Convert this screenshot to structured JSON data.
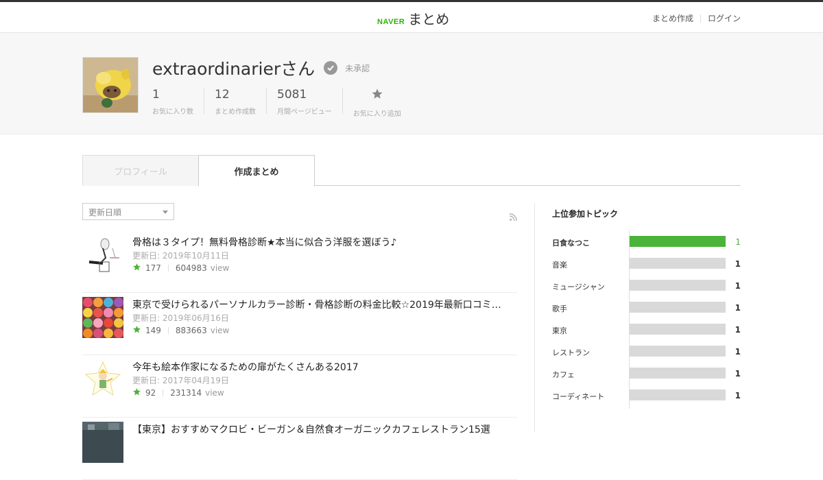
{
  "header": {
    "logo_naver": "NAVER",
    "logo_matome": "まとめ",
    "create_link": "まとめ作成",
    "login_link": "ログイン"
  },
  "profile": {
    "username": "extraordinarierさん",
    "status": "未承認",
    "stats": [
      {
        "num": "1",
        "label": "お気に入り数"
      },
      {
        "num": "12",
        "label": "まとめ作成数"
      },
      {
        "num": "5081",
        "label": "月間ページビュー"
      }
    ],
    "fav_add_label": "お気に入り追加"
  },
  "tabs": {
    "profile": "プロフィール",
    "created": "作成まとめ"
  },
  "sort_select": {
    "value": "更新日順"
  },
  "list": [
    {
      "title": "骨格は３タイプ！無料骨格診断★本当に似合う洋服を選ぼう♪",
      "date": "更新日: 2019年10月11日",
      "favs": "177",
      "views": "604983",
      "view_label": "view"
    },
    {
      "title": "東京で受けられるパーソナルカラー診断・骨格診断の料金比較☆2019年最新口コミ…",
      "date": "更新日: 2019年06月16日",
      "favs": "149",
      "views": "883663",
      "view_label": "view"
    },
    {
      "title": "今年も絵本作家になるための扉がたくさんある2017",
      "date": "更新日: 2017年04月19日",
      "favs": "92",
      "views": "231314",
      "view_label": "view"
    },
    {
      "title": "【東京】おすすめマクロビ・ビーガン＆自然食オーガニックカフェレストラン15選",
      "date": "",
      "favs": "",
      "views": "",
      "view_label": ""
    }
  ],
  "sidebar": {
    "title": "上位参加トピック",
    "topics": [
      {
        "name": "日食なつこ",
        "count": "1"
      },
      {
        "name": "音楽",
        "count": "1"
      },
      {
        "name": "ミュージシャン",
        "count": "1"
      },
      {
        "name": "歌手",
        "count": "1"
      },
      {
        "name": "東京",
        "count": "1"
      },
      {
        "name": "レストラン",
        "count": "1"
      },
      {
        "name": "カフェ",
        "count": "1"
      },
      {
        "name": "コーディネート",
        "count": "1"
      }
    ]
  },
  "colors": {
    "accent_green": "#4cb33a",
    "bar_gray": "#d9d9d9"
  }
}
